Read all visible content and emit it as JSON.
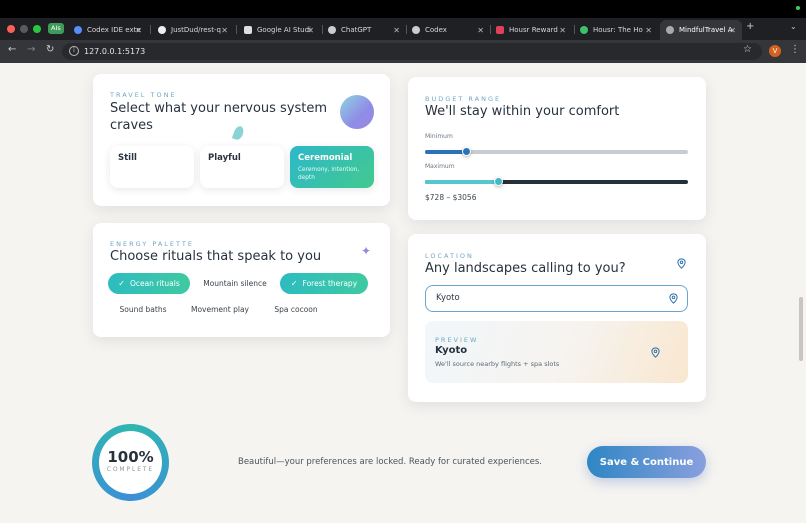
{
  "browser": {
    "tabs": [
      {
        "label": "AIs",
        "kind": "group"
      },
      {
        "label": "Codex IDE exte",
        "fav": "#5b8cff"
      },
      {
        "label": "JustDud/rest-q",
        "fav": "#eeeeee"
      },
      {
        "label": "Google AI Studi",
        "fav": "#dddddd"
      },
      {
        "label": "ChatGPT",
        "fav": "#cccccc"
      },
      {
        "label": "Codex",
        "fav": "#cccccc"
      },
      {
        "label": "Housr Reward",
        "fav": "#e0405a"
      },
      {
        "label": "Housr: The Ho",
        "fav": "#3cc06c"
      },
      {
        "label": "MindfulTravel A",
        "fav": "#aaaaaa"
      }
    ],
    "url": "127.0.0.1:5173",
    "profile_initial": "V"
  },
  "tone": {
    "eyebrow": "TRAVEL TONE",
    "title_line1": "Select what your nervous system",
    "title_line2": "craves",
    "options": [
      {
        "label": "Still"
      },
      {
        "label": "Playful"
      },
      {
        "label": "Ceremonial",
        "sub_line1": "Ceremony, intention,",
        "sub_line2": "depth"
      }
    ]
  },
  "energy": {
    "eyebrow": "ENERGY PALETTE",
    "title": "Choose rituals that speak to you",
    "chips": [
      "Ocean rituals",
      "Mountain silence",
      "Forest therapy",
      "Sound baths",
      "Movement play",
      "Spa cocoon"
    ]
  },
  "budget": {
    "eyebrow": "BUDGET RANGE",
    "title": "We'll stay within your comfort",
    "min_label": "Minimum",
    "max_label": "Maximum",
    "min_fill": 0.16,
    "max_fill": 0.28,
    "range_text": "$728 – $3056"
  },
  "location": {
    "eyebrow": "LOCATION",
    "title": "Any landscapes calling to you?",
    "input_value": "Kyoto",
    "preview": {
      "eyebrow": "PREVIEW",
      "title": "Kyoto",
      "sub": "We'll source nearby flights + spa slots"
    }
  },
  "footer": {
    "progress_value": "100%",
    "progress_label": "COMPLETE",
    "progress_fraction": 1.0,
    "status": "Beautiful—your preferences are locked. Ready for curated experiences.",
    "cta": "Save & Continue"
  },
  "colors": {
    "accent_teal": "#2dbcc0",
    "accent_blue": "#2e86c4",
    "slider_dark": "#26303a"
  }
}
